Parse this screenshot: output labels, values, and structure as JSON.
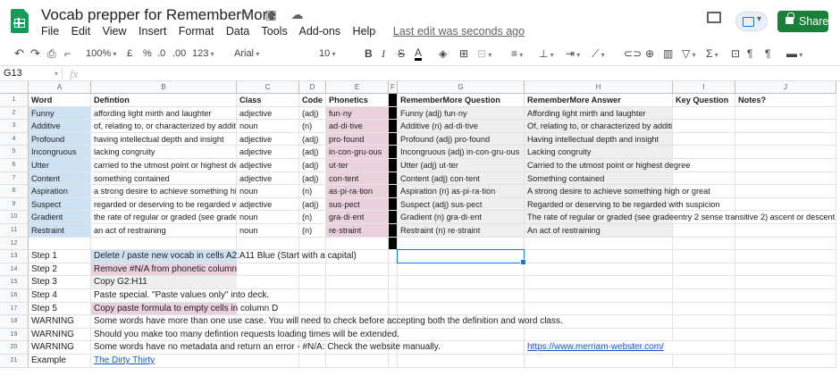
{
  "doc": {
    "title": "Vocab prepper for RememberMore",
    "title_icons": "☆ ▣ ☁",
    "menu": [
      "File",
      "Edit",
      "View",
      "Insert",
      "Format",
      "Data",
      "Tools",
      "Add-ons",
      "Help"
    ],
    "last_edit": "Last edit was seconds ago",
    "share_label": "Share"
  },
  "toolbar": {
    "zoom": "100%",
    "currency": "£",
    "percent": "%",
    "dec_less": ".0",
    "dec_more": ".00",
    "more_formats": "123",
    "font": "Arial",
    "font_size": "10",
    "bold": "B",
    "italic": "I",
    "strike": "S",
    "text_color": "A"
  },
  "formula_bar": {
    "name_box": "G13",
    "fx": "fx",
    "value": ""
  },
  "columns": [
    "A",
    "B",
    "C",
    "D",
    "E",
    "F",
    "G",
    "H",
    "I",
    "J"
  ],
  "rows": [
    "1",
    "2",
    "3",
    "4",
    "5",
    "6",
    "7",
    "8",
    "9",
    "10",
    "11",
    "12",
    "13",
    "14",
    "15",
    "16",
    "17",
    "18",
    "19",
    "20",
    "21"
  ],
  "header_row": {
    "a": "Word",
    "b": "Defintion",
    "c": "Class",
    "d": "Code",
    "e": "Phonetics",
    "g": "RememberMore Question",
    "h": "RememberMore Answer",
    "i": "Key Question",
    "j": "Notes?"
  },
  "vocab": [
    {
      "word": "Funny",
      "definition": "affording light mirth and laughter",
      "cls": "adjective",
      "code": "(adj)",
      "phon": "fun·ny",
      "question": "Funny (adj) fun·ny",
      "answer": "Affording light mirth and laughter"
    },
    {
      "word": "Additive",
      "definition": "of, relating to, or characterized by addition",
      "cls": "noun",
      "code": "(n)",
      "phon": "ad·di·tive",
      "question": "Additive (n) ad·di·tive",
      "answer": "Of, relating to, or characterized by addition"
    },
    {
      "word": "Profound",
      "definition": "having intellectual depth and insight",
      "cls": "adjective",
      "code": "(adj)",
      "phon": "pro·found",
      "question": "Profound (adj) pro·found",
      "answer": "Having intellectual depth and insight"
    },
    {
      "word": "Incongruous",
      "definition": "lacking congruity",
      "cls": "adjective",
      "code": "(adj)",
      "phon": "in·con·gru·ous",
      "question": "Incongruous (adj) in·con·gru·ous",
      "answer": "Lacking congruity"
    },
    {
      "word": "Utter",
      "definition": "carried to the utmost point or highest degree",
      "cls": "adjective",
      "code": "(adj)",
      "phon": "ut·ter",
      "question": "Utter (adj) ut·ter",
      "answer": "Carried to the utmost point or highest degree"
    },
    {
      "word": "Content",
      "definition": "something contained",
      "cls": "adjective",
      "code": "(adj)",
      "phon": "con·tent",
      "question": "Content (adj) con·tent",
      "answer": "Something contained"
    },
    {
      "word": "Aspiration",
      "definition": "a strong desire to achieve something high or great",
      "cls": "noun",
      "code": "(n)",
      "phon": "as·pi·ra·tion",
      "question": "Aspiration (n) as·pi·ra·tion",
      "answer": "A strong desire to achieve something high or great"
    },
    {
      "word": "Suspect",
      "definition": "regarded or deserving to be regarded with suspicion",
      "cls": "adjective",
      "code": "(adj)",
      "phon": "sus·pect",
      "question": "Suspect (adj) sus·pect",
      "answer": "Regarded or deserving to be regarded with suspicion"
    },
    {
      "word": "Gradient",
      "definition": "the rate of regular or graded (see gradeentry 2 sense transitive 2) ascent or descent",
      "cls": "noun",
      "code": "(n)",
      "phon": "gra·di·ent",
      "question": "Gradient (n) gra·di·ent",
      "answer": "The rate of regular or graded (see gradeentry 2 sense transitive 2) ascent or descent"
    },
    {
      "word": "Restraint",
      "definition": "an act of restraining",
      "cls": "noun",
      "code": "(n)",
      "phon": "re·straint",
      "question": "Restraint (n) re·straint",
      "answer": "An act of restraining"
    }
  ],
  "steps": [
    {
      "label": "Step 1",
      "text": "Delete / paste new vocab in cells A2:A11 Blue (Start with a capital)",
      "hl": "blue"
    },
    {
      "label": "Step 2",
      "text": "Remove #N/A from phonetic column",
      "hl": "pink"
    },
    {
      "label": "Step 3",
      "text": "Copy G2:H11",
      "hl": "grey"
    },
    {
      "label": "Step 4",
      "text": "Paste special. \"Paste values only\" into deck.",
      "hl": ""
    },
    {
      "label": "Step 5",
      "text": "Copy paste formula to empty cells in column D",
      "hl": "pink"
    },
    {
      "label": "WARNING",
      "text": "Some words have more than one use case. You will need to check before accepting both the definition and word class.",
      "hl": ""
    },
    {
      "label": "WARNING",
      "text": "Should you make too many defintion requests loading times will be extended.",
      "hl": ""
    },
    {
      "label": "WARNING",
      "text": "Some words have no metadata and return an error - #N/A: Check the website manually.",
      "hl": ""
    },
    {
      "label": "Example",
      "text": "The Dirty Thirty",
      "hl": "link"
    }
  ],
  "merriam_link": "https://www.merriam-webster.com/",
  "colors": {
    "blue_fill": "#cfe2f3",
    "pink_fill": "#ead1dc",
    "grey_fill": "#efefef",
    "share_green": "#188038",
    "selection": "#1a73e8"
  }
}
